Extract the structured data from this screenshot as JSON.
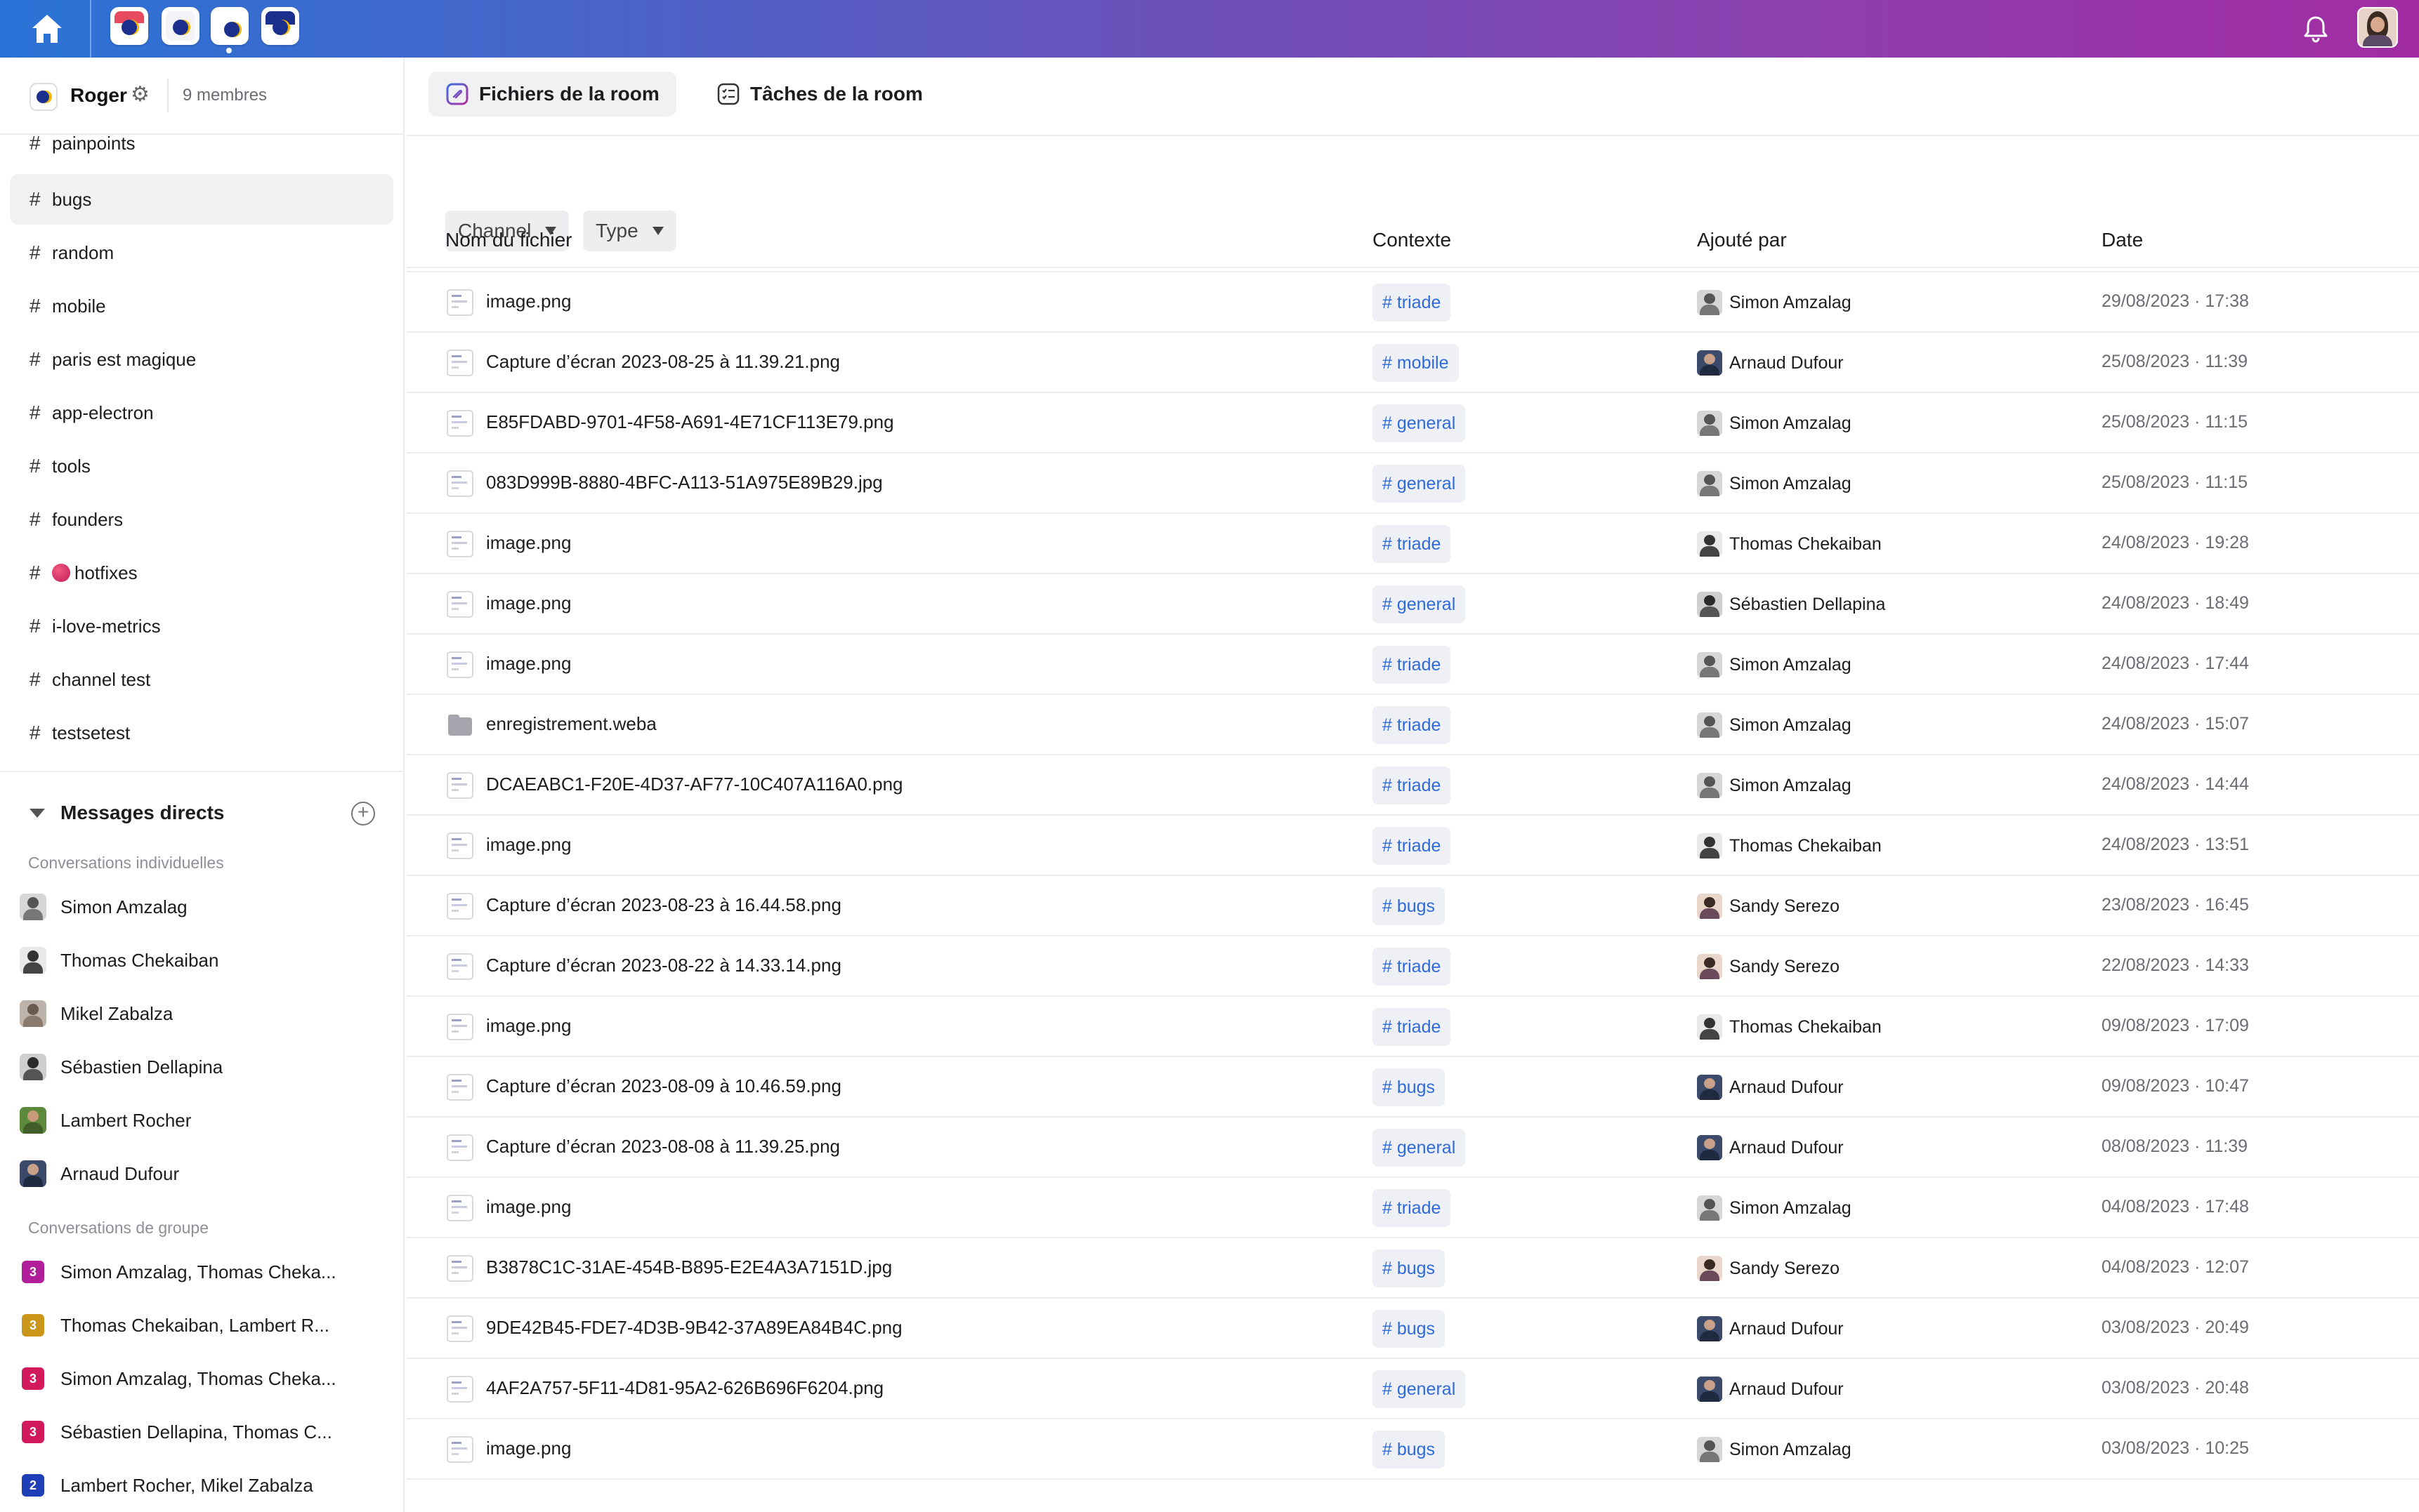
{
  "topbar": {
    "workspaces": [
      "workspace-1",
      "workspace-2",
      "workspace-roger",
      "workspace-4"
    ],
    "icons": {
      "home": "home-icon",
      "notifications": "bell-icon"
    }
  },
  "room": {
    "name": "Roger",
    "members": "9 membres"
  },
  "channels": [
    {
      "name": "painpoints"
    },
    {
      "name": "bugs"
    },
    {
      "name": "random"
    },
    {
      "name": "mobile"
    },
    {
      "name": "paris est magique"
    },
    {
      "name": "app-electron"
    },
    {
      "name": "tools"
    },
    {
      "name": "founders"
    },
    {
      "name": "hotfixes"
    },
    {
      "name": "i-love-metrics"
    },
    {
      "name": "channel test"
    },
    {
      "name": "testsetest"
    }
  ],
  "direct_messages": {
    "title": "Messages directs",
    "individual_label": "Conversations individuelles",
    "individual": [
      {
        "name": "Simon Amzalag"
      },
      {
        "name": "Thomas Chekaiban"
      },
      {
        "name": "Mikel Zabalza"
      },
      {
        "name": "Sébastien Dellapina"
      },
      {
        "name": "Lambert Rocher"
      },
      {
        "name": "Arnaud Dufour"
      }
    ],
    "group_label": "Conversations de groupe",
    "groups": [
      {
        "count": "3",
        "name": "Simon Amzalag, Thomas Cheka...",
        "color": "#b01e9a"
      },
      {
        "count": "3",
        "name": "Thomas Chekaiban, Lambert R...",
        "color": "#c9961a"
      },
      {
        "count": "3",
        "name": "Simon Amzalag, Thomas Cheka...",
        "color": "#d1195b"
      },
      {
        "count": "3",
        "name": "Sébastien Dellapina, Thomas C...",
        "color": "#d1195b"
      },
      {
        "count": "2",
        "name": "Lambert Rocher, Mikel Zabalza",
        "color": "#1e3fb8"
      }
    ]
  },
  "tabs": [
    {
      "label": "Fichiers de la room"
    },
    {
      "label": "Tâches de la room"
    }
  ],
  "filters": [
    {
      "label": "Channel"
    },
    {
      "label": "Type"
    }
  ],
  "table": {
    "columns": [
      "Nom du fichier",
      "Contexte",
      "Ajouté par",
      "Date"
    ],
    "rows": [
      {
        "file": "image.png",
        "context": "# triade",
        "added_by": "Simon Amzalag",
        "date": "29/08/2023 · 17:38"
      },
      {
        "file": "Capture d’écran 2023-08-25 à 11.39.21.png",
        "context": "# mobile",
        "added_by": "Arnaud Dufour",
        "date": "25/08/2023 · 11:39"
      },
      {
        "file": "E85FDABD-9701-4F58-A691-4E71CF113E79.png",
        "context": "# general",
        "added_by": "Simon Amzalag",
        "date": "25/08/2023 · 11:15"
      },
      {
        "file": "083D999B-8880-4BFC-A113-51A975E89B29.jpg",
        "context": "# general",
        "added_by": "Simon Amzalag",
        "date": "25/08/2023 · 11:15"
      },
      {
        "file": "image.png",
        "context": "# triade",
        "added_by": "Thomas Chekaiban",
        "date": "24/08/2023 · 19:28"
      },
      {
        "file": "image.png",
        "context": "# general",
        "added_by": "Sébastien Dellapina",
        "date": "24/08/2023 · 18:49"
      },
      {
        "file": "image.png",
        "context": "# triade",
        "added_by": "Simon Amzalag",
        "date": "24/08/2023 · 17:44"
      },
      {
        "file": "enregistrement.weba",
        "context": "# triade",
        "added_by": "Simon Amzalag",
        "date": "24/08/2023 · 15:07"
      },
      {
        "file": "DCAEABC1-F20E-4D37-AF77-10C407A116A0.png",
        "context": "# triade",
        "added_by": "Simon Amzalag",
        "date": "24/08/2023 · 14:44"
      },
      {
        "file": "image.png",
        "context": "# triade",
        "added_by": "Thomas Chekaiban",
        "date": "24/08/2023 · 13:51"
      },
      {
        "file": "Capture d’écran 2023-08-23 à 16.44.58.png",
        "context": "# bugs",
        "added_by": "Sandy Serezo",
        "date": "23/08/2023 · 16:45"
      },
      {
        "file": "Capture d’écran 2023-08-22 à 14.33.14.png",
        "context": "# triade",
        "added_by": "Sandy Serezo",
        "date": "22/08/2023 · 14:33"
      },
      {
        "file": "image.png",
        "context": "# triade",
        "added_by": "Thomas Chekaiban",
        "date": "09/08/2023 · 17:09"
      },
      {
        "file": "Capture d’écran 2023-08-09 à 10.46.59.png",
        "context": "# bugs",
        "added_by": "Arnaud Dufour",
        "date": "09/08/2023 · 10:47"
      },
      {
        "file": "Capture d’écran 2023-08-08 à 11.39.25.png",
        "context": "# general",
        "added_by": "Arnaud Dufour",
        "date": "08/08/2023 · 11:39"
      },
      {
        "file": "image.png",
        "context": "# triade",
        "added_by": "Simon Amzalag",
        "date": "04/08/2023 · 17:48"
      },
      {
        "file": "B3878C1C-31AE-454B-B895-E2E4A3A7151D.jpg",
        "context": "# bugs",
        "added_by": "Sandy Serezo",
        "date": "04/08/2023 · 12:07"
      },
      {
        "file": "9DE42B45-FDE7-4D3B-9B42-37A89EA84B4C.png",
        "context": "# bugs",
        "added_by": "Arnaud Dufour",
        "date": "03/08/2023 · 20:49"
      },
      {
        "file": "4AF2A757-5F11-4D81-95A2-626B696F6204.png",
        "context": "# general",
        "added_by": "Arnaud Dufour",
        "date": "03/08/2023 · 20:48"
      },
      {
        "file": "image.png",
        "context": "# bugs",
        "added_by": "Simon Amzalag",
        "date": "03/08/2023 · 10:25"
      }
    ]
  },
  "colors": {
    "accent_link": "#2f6bd8",
    "gradient_start": "#2a73d6",
    "gradient_end": "#a22ca3"
  }
}
